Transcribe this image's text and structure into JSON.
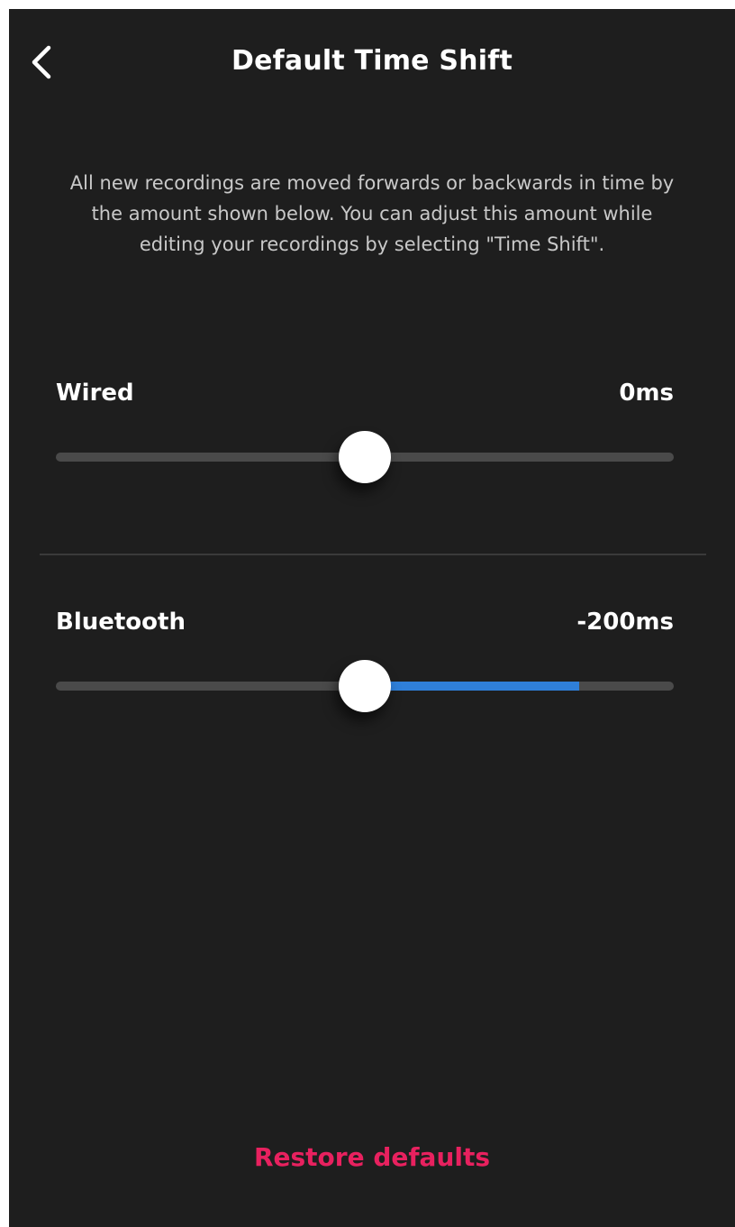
{
  "header": {
    "title": "Default Time Shift",
    "back_icon": "chevron-left-icon"
  },
  "description": "All new recordings are moved forwards or backwards in time by the amount shown below. You can adjust this amount while editing your recordings by selecting \"Time Shift\".",
  "settings": [
    {
      "label": "Wired",
      "value": "0ms",
      "thumb_position": 0.5,
      "fill_start": 0.5,
      "fill_end": 0.5
    },
    {
      "label": "Bluetooth",
      "value": "-200ms",
      "thumb_position": 0.5,
      "fill_start": 0.5,
      "fill_end": 0.847
    }
  ],
  "footer": {
    "restore_label": "Restore defaults"
  },
  "colors": {
    "background": "#1e1e1e",
    "accent_blue": "#2f7fd9",
    "accent_pink": "#e8215f",
    "track": "#4a4a4a"
  }
}
